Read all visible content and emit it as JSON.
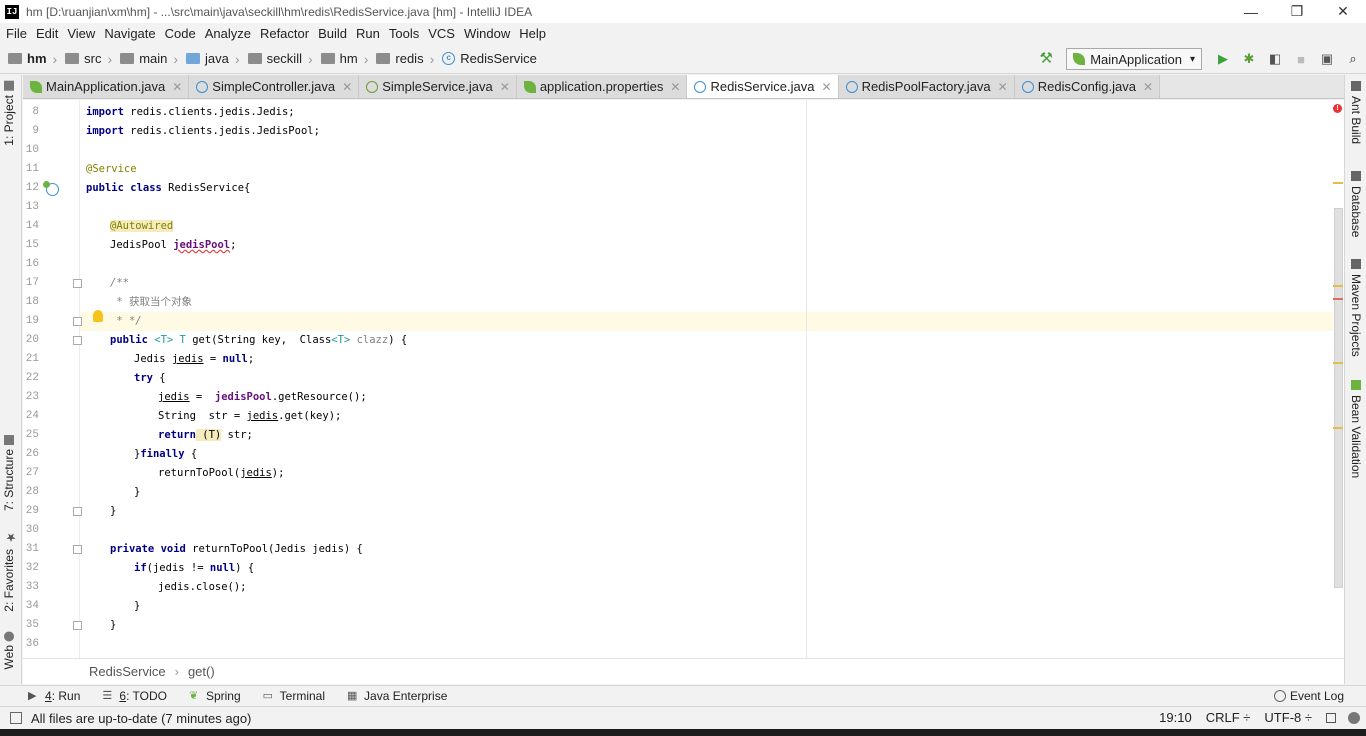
{
  "window": {
    "app_icon": "IJ",
    "title": "hm [D:\\ruanjian\\xm\\hm] - ...\\src\\main\\java\\seckill\\hm\\redis\\RedisService.java [hm] - IntelliJ IDEA",
    "minimize": "—",
    "restore": "❐",
    "close": "✕"
  },
  "menu": [
    "File",
    "Edit",
    "View",
    "Navigate",
    "Code",
    "Analyze",
    "Refactor",
    "Build",
    "Run",
    "Tools",
    "VCS",
    "Window",
    "Help"
  ],
  "nav": {
    "crumbs": [
      "hm",
      "src",
      "main",
      "java",
      "seckill",
      "hm",
      "redis",
      "RedisService"
    ],
    "run_config": "MainApplication"
  },
  "left_tools": [
    "1: Project",
    "7: Structure",
    "2: Favorites",
    "Web"
  ],
  "right_tools": [
    "Ant Build",
    "Database",
    "Maven Projects",
    "Bean Validation"
  ],
  "tabs": [
    {
      "label": "MainApplication.java",
      "icon": "spring-leaf-icon"
    },
    {
      "label": "SimpleController.java",
      "icon": "class-icon"
    },
    {
      "label": "SimpleService.java",
      "icon": "interface-icon"
    },
    {
      "label": "application.properties",
      "icon": "spring-leaf-icon"
    },
    {
      "label": "RedisService.java",
      "icon": "class-icon"
    },
    {
      "label": "RedisPoolFactory.java",
      "icon": "class-icon"
    },
    {
      "label": "RedisConfig.java",
      "icon": "class-icon"
    }
  ],
  "active_tab": "RedisService.java",
  "editor": {
    "line_numbers": [
      "8",
      "9",
      "10",
      "11",
      "12",
      "13",
      "14",
      "15",
      "16",
      "17",
      "18",
      "19",
      "20",
      "21",
      "22",
      "23",
      "24",
      "25",
      "26",
      "27",
      "28",
      "29",
      "30",
      "31",
      "32",
      "33",
      "34",
      "35",
      "36"
    ],
    "current_line": "19",
    "code": {
      "l8_kw": "import",
      "l8_rest": " redis.clients.jedis.Jedis;",
      "l9_kw": "import",
      "l9_rest": " redis.clients.jedis.JedisPool;",
      "l11": "@Service",
      "l12_kw": "public class",
      "l12_rest": " RedisService{",
      "l14": "@Autowired",
      "l15_type": "JedisPool ",
      "l15_field": "jedisPool",
      "l15_end": ";",
      "l17": "/**",
      "l18_star": " * ",
      "l18_text": "获取当个对象",
      "l19": " * */",
      "l20_kw": "public",
      "l20_t1": " <T>",
      "l20_t2": " T",
      "l20_mid": " get(String key,  Class",
      "l20_t3": "<T>",
      "l20_unused": " clazz",
      "l20_end": ") {",
      "l21_a": "Jedis ",
      "l21_var": "jedis",
      "l21_b": " = ",
      "l21_kw": "null",
      "l21_c": ";",
      "l22_kw": "try",
      "l22_rest": " {",
      "l23_var": "jedis",
      "l23_b": " =  ",
      "l23_field": "jedisPool",
      "l23_c": ".getResource();",
      "l24_a": "String  str = ",
      "l24_var": "jedis",
      "l24_b": ".get(key);",
      "l25_kw": "return",
      "l25_cast": " (T)",
      "l25_rest": " str;",
      "l26_a": "}",
      "l26_kw": "finally",
      "l26_b": " {",
      "l27_a": "returnToPool(",
      "l27_var": "jedis",
      "l27_b": ");",
      "l28": "}",
      "l29": "}",
      "l31_kw": "private void",
      "l31_rest": " returnToPool(Jedis jedis) {",
      "l32_kw": "if",
      "l32_a": "(jedis != ",
      "l32_kw2": "null",
      "l32_b": ") {",
      "l33": "jedis.close();",
      "l34": "}",
      "l35": "}",
      "l37": "}"
    },
    "error_badge": "!"
  },
  "breadcrumb": [
    "RedisService",
    "get()"
  ],
  "bottom_tools": [
    {
      "mnemonic": "4",
      "label": ": Run",
      "icon": "play-icon"
    },
    {
      "mnemonic": "6",
      "label": ": TODO",
      "icon": "list-icon"
    },
    {
      "mnemonic": "",
      "label": "Spring",
      "icon": "spring-leaf-icon"
    },
    {
      "mnemonic": "",
      "label": "Terminal",
      "icon": "terminal-icon"
    },
    {
      "mnemonic": "",
      "label": "Java Enterprise",
      "icon": "java-enterprise-icon"
    }
  ],
  "event_log": "Event Log",
  "status": {
    "message": "All files are up-to-date (7 minutes ago)",
    "position": "19:10",
    "line_sep": "CRLF ÷",
    "encoding": "UTF-8 ÷"
  },
  "colors": {
    "keyword": "#000080",
    "annotation": "#808000",
    "field": "#660e7a",
    "comment": "#808080",
    "type_param": "#20999d",
    "current_line": "#fffae3"
  }
}
